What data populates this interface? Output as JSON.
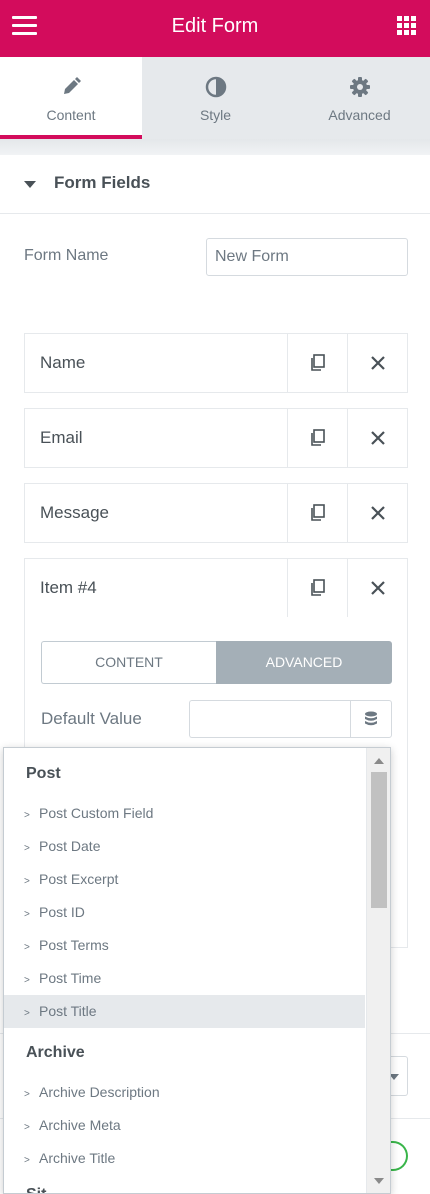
{
  "header": {
    "title": "Edit Form",
    "background_color": "#d30c5c",
    "menu_icon": "hamburger-icon",
    "widgets_icon": "grid-icon"
  },
  "tabs": [
    {
      "label": "Content",
      "icon": "pencil-icon",
      "active": true
    },
    {
      "label": "Style",
      "icon": "half-circle-icon",
      "active": false
    },
    {
      "label": "Advanced",
      "icon": "gear-icon",
      "active": false
    }
  ],
  "section": {
    "title": "Form Fields"
  },
  "form_name": {
    "label": "Form Name",
    "value": "New Form"
  },
  "fields": [
    {
      "title": "Name"
    },
    {
      "title": "Email"
    },
    {
      "title": "Message"
    },
    {
      "title": "Item #4"
    }
  ],
  "item_panel": {
    "content_tab": "CONTENT",
    "advanced_tab": "ADVANCED",
    "default_value_label": "Default Value",
    "default_value": ""
  },
  "dynamic_dropdown": {
    "groups": [
      {
        "title": "Post",
        "items": [
          {
            "label": "Post Custom Field"
          },
          {
            "label": "Post Date"
          },
          {
            "label": "Post Excerpt"
          },
          {
            "label": "Post ID"
          },
          {
            "label": "Post Terms"
          },
          {
            "label": "Post Time"
          },
          {
            "label": "Post Title",
            "highlighted": true
          }
        ]
      },
      {
        "title": "Archive",
        "items": [
          {
            "label": "Archive Description"
          },
          {
            "label": "Archive Meta"
          },
          {
            "label": "Archive Title"
          }
        ]
      }
    ],
    "partial_group": "Sit"
  }
}
